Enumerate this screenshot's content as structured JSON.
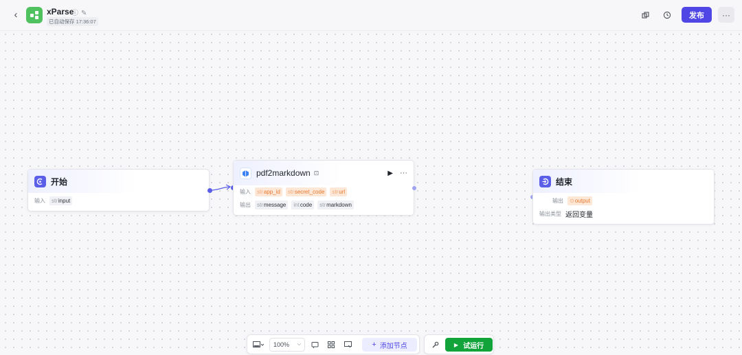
{
  "header": {
    "app_title": "xParse",
    "autosave": "已自动保存 17:36:07",
    "publish_label": "发布",
    "more_label": "···"
  },
  "nodes": {
    "start": {
      "title": "开始",
      "input_label": "输入",
      "input_type": "str",
      "input_name": "input"
    },
    "pdf2markdown": {
      "title": "pdf2markdown",
      "input_label": "输入",
      "inputs": [
        {
          "type": "str",
          "name": "app_id"
        },
        {
          "type": "str",
          "name": "secret_code"
        },
        {
          "type": "str",
          "name": "url"
        }
      ],
      "output_label": "输出",
      "outputs": [
        {
          "type": "str",
          "name": "message"
        },
        {
          "type": "int",
          "name": "code"
        },
        {
          "type": "str",
          "name": "markdown"
        }
      ]
    },
    "end": {
      "title": "结束",
      "output_label": "输出",
      "output_name": "output",
      "output_type_label": "输出类型",
      "output_type_value": "返回变量"
    }
  },
  "toolbar": {
    "zoom": "100%",
    "add_node_label": "添加节点",
    "run_label": "试运行"
  },
  "colors": {
    "accent": "#5046e5",
    "run_green": "#12a43a",
    "logo_green": "#4fc25f",
    "var_orange": "#e8772c"
  }
}
